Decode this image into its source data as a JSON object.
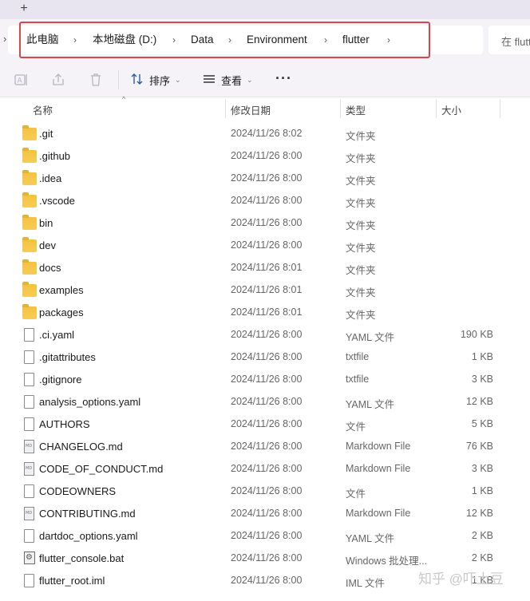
{
  "tabstrip": {
    "new_tab_glyph": "+"
  },
  "breadcrumb": {
    "items": [
      "此电脑",
      "本地磁盘 (D:)",
      "Data",
      "Environment",
      "flutter"
    ]
  },
  "search": {
    "placeholder": "在 flutt"
  },
  "commandbar": {
    "sort_label": "排序",
    "view_label": "查看",
    "more_glyph": "···",
    "icons": [
      "rename-icon",
      "share-icon",
      "delete-icon",
      "sort-icon",
      "view-icon"
    ]
  },
  "columns": {
    "name": "名称",
    "modified": "修改日期",
    "type": "类型",
    "size": "大小"
  },
  "files": [
    {
      "kind": "folder",
      "name": ".git",
      "modified": "2024/11/26 8:02",
      "type": "文件夹",
      "size": ""
    },
    {
      "kind": "folder",
      "name": ".github",
      "modified": "2024/11/26 8:00",
      "type": "文件夹",
      "size": ""
    },
    {
      "kind": "folder",
      "name": ".idea",
      "modified": "2024/11/26 8:00",
      "type": "文件夹",
      "size": ""
    },
    {
      "kind": "folder",
      "name": ".vscode",
      "modified": "2024/11/26 8:00",
      "type": "文件夹",
      "size": ""
    },
    {
      "kind": "folder",
      "name": "bin",
      "modified": "2024/11/26 8:00",
      "type": "文件夹",
      "size": ""
    },
    {
      "kind": "folder",
      "name": "dev",
      "modified": "2024/11/26 8:00",
      "type": "文件夹",
      "size": ""
    },
    {
      "kind": "folder",
      "name": "docs",
      "modified": "2024/11/26 8:01",
      "type": "文件夹",
      "size": ""
    },
    {
      "kind": "folder",
      "name": "examples",
      "modified": "2024/11/26 8:01",
      "type": "文件夹",
      "size": ""
    },
    {
      "kind": "folder",
      "name": "packages",
      "modified": "2024/11/26 8:01",
      "type": "文件夹",
      "size": ""
    },
    {
      "kind": "file",
      "name": ".ci.yaml",
      "modified": "2024/11/26 8:00",
      "type": "YAML 文件",
      "size": "190 KB"
    },
    {
      "kind": "file",
      "name": ".gitattributes",
      "modified": "2024/11/26 8:00",
      "type": "txtfile",
      "size": "1 KB"
    },
    {
      "kind": "file",
      "name": ".gitignore",
      "modified": "2024/11/26 8:00",
      "type": "txtfile",
      "size": "3 KB"
    },
    {
      "kind": "file",
      "name": "analysis_options.yaml",
      "modified": "2024/11/26 8:00",
      "type": "YAML 文件",
      "size": "12 KB"
    },
    {
      "kind": "file",
      "name": "AUTHORS",
      "modified": "2024/11/26 8:00",
      "type": "文件",
      "size": "5 KB"
    },
    {
      "kind": "md",
      "name": "CHANGELOG.md",
      "modified": "2024/11/26 8:00",
      "type": "Markdown File",
      "size": "76 KB"
    },
    {
      "kind": "md",
      "name": "CODE_OF_CONDUCT.md",
      "modified": "2024/11/26 8:00",
      "type": "Markdown File",
      "size": "3 KB"
    },
    {
      "kind": "file",
      "name": "CODEOWNERS",
      "modified": "2024/11/26 8:00",
      "type": "文件",
      "size": "1 KB"
    },
    {
      "kind": "md",
      "name": "CONTRIBUTING.md",
      "modified": "2024/11/26 8:00",
      "type": "Markdown File",
      "size": "12 KB"
    },
    {
      "kind": "file",
      "name": "dartdoc_options.yaml",
      "modified": "2024/11/26 8:00",
      "type": "YAML 文件",
      "size": "2 KB"
    },
    {
      "kind": "bat",
      "name": "flutter_console.bat",
      "modified": "2024/11/26 8:00",
      "type": "Windows 批处理...",
      "size": "2 KB"
    },
    {
      "kind": "file",
      "name": "flutter_root.iml",
      "modified": "2024/11/26 8:00",
      "type": "IML 文件",
      "size": "1 KB"
    }
  ],
  "watermark": "知乎 @吓土豆"
}
